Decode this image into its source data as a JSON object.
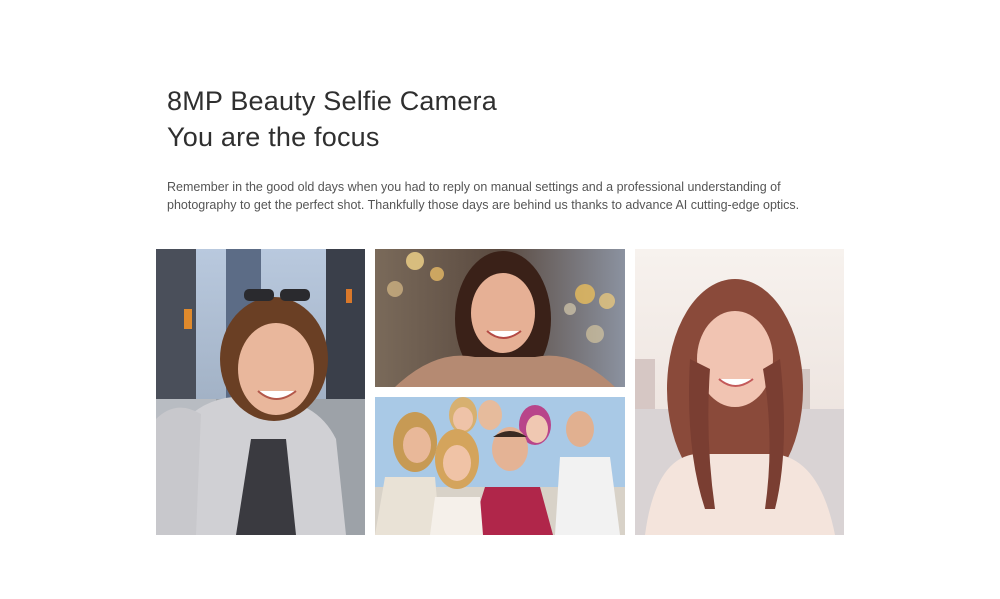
{
  "heading": {
    "line1": "8MP Beauty Selfie Camera",
    "line2": "You are the focus"
  },
  "description": "Remember in the good old days when you had to reply on manual settings and a professional understanding of photography to get the perfect shot. Thankfully those days are behind us thanks to advance AI cutting-edge optics.",
  "photos": [
    {
      "subject": "woman-with-sunglasses-city-street"
    },
    {
      "subject": "woman-bokeh-lights"
    },
    {
      "subject": "group-of-friends"
    },
    {
      "subject": "woman-waterfront"
    }
  ]
}
